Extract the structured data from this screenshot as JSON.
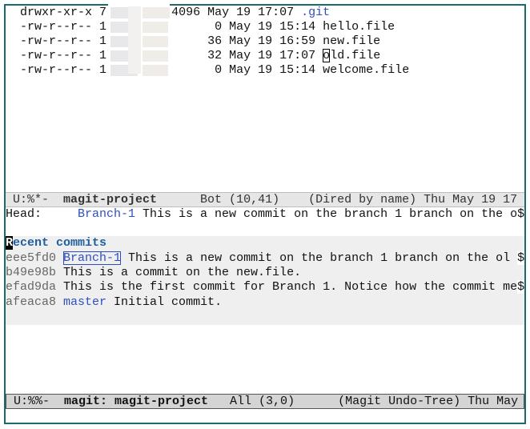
{
  "dired": {
    "entries": [
      {
        "perms": "drwxr-xr-x",
        "links": "7",
        "size": "4096",
        "date": "May 19 17:07",
        "name": ".git"
      },
      {
        "perms": "-rw-r--r--",
        "links": "1",
        "size": "0",
        "date": "May 19 15:14",
        "name": "hello.file"
      },
      {
        "perms": "-rw-r--r--",
        "links": "1",
        "size": "36",
        "date": "May 19 16:59",
        "name": "new.file"
      },
      {
        "perms": "-rw-r--r--",
        "links": "1",
        "size": "32",
        "date": "May 19 17:07",
        "name_cursor": "o",
        "name_rest": "ld.file"
      },
      {
        "perms": "-rw-r--r--",
        "links": "1",
        "size": "0",
        "date": "May 19 15:14",
        "name": "welcome.file"
      }
    ],
    "modeline": {
      "status": " U:%*-  ",
      "buffer": "magit-project",
      "rest": "      Bot (10,41)    (Dired by name) Thu May 19 17"
    }
  },
  "magit": {
    "head_label": "Head:     ",
    "head_branch": "Branch-1",
    "head_message": " This is a new commit on the branch 1 branch on the o",
    "wrap": "$",
    "recent_heading_cursor": "R",
    "recent_heading_rest": "ecent commits",
    "commits": [
      {
        "hash": "eee5fd0",
        "branch": "Branch-1",
        "message": " This is a new commit on the branch 1 branch on the ol ",
        "wrap": "$"
      },
      {
        "hash": "b49e98b",
        "message": " This is a commit on the new.file."
      },
      {
        "hash": "efad9da",
        "message": " This is the first commit for Branch 1. Notice how the commit me",
        "wrap": "$"
      },
      {
        "hash": "afeaca8",
        "branch": "master",
        "message": " Initial commit."
      }
    ],
    "modeline": {
      "status": " U:%%-  ",
      "buffer": "magit: magit-project",
      "rest": "   All (3,0)      (Magit Undo-Tree) Thu May"
    }
  },
  "colors": {
    "frame": "#1b6b6b",
    "branch": "#2f4fbf",
    "heading": "#1d5fa0"
  }
}
